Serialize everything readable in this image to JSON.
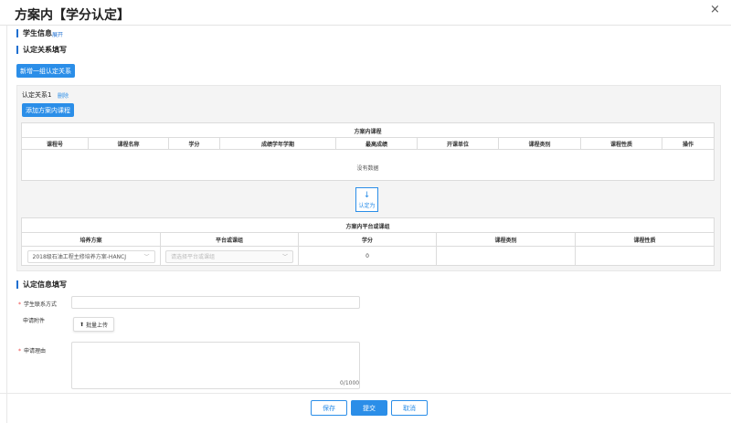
{
  "dialog": {
    "title": "方案内【学分认定】",
    "close": "×"
  },
  "student_info": {
    "title": "学生信息",
    "toggle": "展开"
  },
  "relation": {
    "title": "认定关系填写",
    "add_group_button": "新增一组认定关系",
    "group_label": "认定关系1",
    "delete_link": "删除",
    "add_course_button": "添加方案内课程"
  },
  "course_table": {
    "caption": "方案内课程",
    "headers": [
      "课程号",
      "课程名称",
      "学分",
      "成绩学年学期",
      "最高成绩",
      "开课单位",
      "课程类别",
      "课程性质",
      "操作"
    ],
    "empty_text": "没有数据"
  },
  "convert": {
    "icon": "arrow-down-icon",
    "glyph": "↓",
    "label": "认定为"
  },
  "platform_table": {
    "caption": "方案内平台或课组",
    "headers": [
      "培养方案",
      "平台或课组",
      "学分",
      "课程类别",
      "课程性质"
    ],
    "row": {
      "plan_value": "2018级石油工程主修培养方案-HANCJ",
      "platform_placeholder": "请选择平台或课组",
      "credit": "0",
      "category": "",
      "nature": ""
    }
  },
  "form": {
    "title": "认定信息填写",
    "contact_label": "学生联系方式",
    "contact_value": "",
    "attachment_label": "申请附件",
    "upload_button": "批量上传",
    "reason_label": "申请理由",
    "reason_value": "",
    "counter": "0/1000"
  },
  "footer": {
    "save": "保存",
    "submit": "提交",
    "cancel": "取消"
  },
  "colors": {
    "accent": "#2b8ee8",
    "required": "#e44444"
  }
}
